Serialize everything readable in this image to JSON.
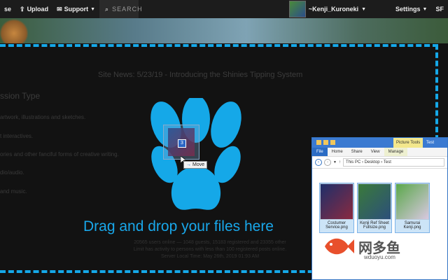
{
  "nav": {
    "browse_label": "se",
    "upload_label": "Upload",
    "support_label": "Support",
    "search_label": "SEARCH",
    "username": "~Kenji_Kuroneki",
    "settings_label": "Settings",
    "overflow_label": "SF"
  },
  "site": {
    "news": "Site News: 5/23/19 - Introducing the Shinies Tipping System",
    "section_title": "ssion Type",
    "lines": [
      "artwork, illustrations and sketches.",
      "t interactives.",
      "ories and other fanciful forms of creative writing.",
      "dio/audio.",
      "and music."
    ],
    "drop_text": "Drag and drop your files here",
    "stats_1": "20565 users online — 1048 guests, 15183 registered and 23355 other",
    "stats_2": "Limit has activity to persons with less than 100 registered posts online.",
    "stats_3": "Server Local Time: May 26th, 2019 01:93 AM"
  },
  "drag": {
    "count": "3",
    "tooltip": "Move"
  },
  "explorer": {
    "ctx_tab": "Picture Tools",
    "folder_name": "Test",
    "tabs": [
      "File",
      "Home",
      "Share",
      "View",
      "Manage"
    ],
    "path": "This PC › Desktop › Test",
    "files": [
      {
        "name": "Costumer Service.png"
      },
      {
        "name": "Kenji Ref Sheet Fullsize.png"
      },
      {
        "name": "Samurai Kenji.png"
      }
    ]
  },
  "watermark": {
    "text": "网多鱼",
    "url": "wduoyu.com"
  },
  "colors": {
    "accent_blue": "#15a8e8",
    "explorer_blue": "#3b7ad1",
    "watermark_fish": "#e8502c"
  }
}
